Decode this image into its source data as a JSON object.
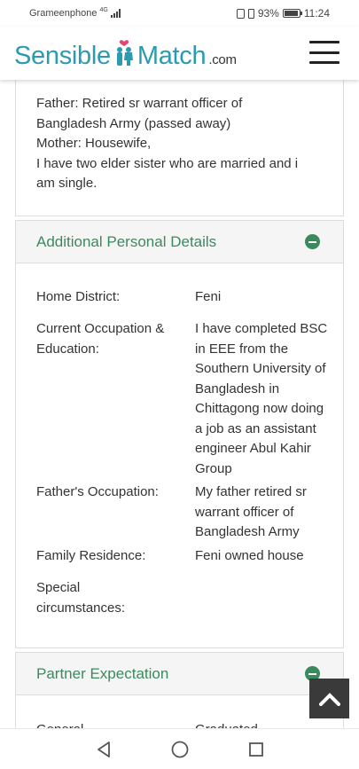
{
  "status_bar": {
    "carrier": "Grameenphone",
    "network": "4G",
    "battery_percent": "93%",
    "battery_level": 0.93,
    "time": "11:24"
  },
  "header": {
    "logo_part1": "Sensible",
    "logo_part2": "Match",
    "logo_suffix": ".com",
    "menu_icon": "hamburger-icon"
  },
  "family_info": {
    "lines": [
      "Father: Retired sr warrant officer of",
      "Bangladesh Army (passed away)",
      "Mother: Housewife,",
      "I have two elder sister who are married and i",
      "am single."
    ]
  },
  "additional_details": {
    "title": "Additional Personal Details",
    "toggle_icon": "minus-circle-icon",
    "rows": [
      {
        "label": "Home District:",
        "value": "Feni"
      },
      {
        "label": "Current Occupation & Education:",
        "value": "I have completed BSC in EEE from the Southern University of Bangladesh in Chittagong now doing a job as an assistant engineer Abul Kahir Group"
      },
      {
        "label": "Father's Occupation:",
        "value": "My father retired sr warrant officer of Bangladesh Army"
      },
      {
        "label": "Family Residence:",
        "value": "Feni owned house"
      },
      {
        "label": "Special circumstances:",
        "value": ""
      }
    ]
  },
  "partner_expectation": {
    "title": "Partner Expectation",
    "toggle_icon": "minus-circle-icon",
    "first_row": {
      "label": "General",
      "value": "Graduated"
    }
  },
  "scroll_top_icon": "chevron-up-icon",
  "nav": {
    "back_icon": "back-triangle-icon",
    "home_icon": "home-circle-icon",
    "recents_icon": "recents-square-icon"
  },
  "colors": {
    "brand_teal": "#2a9bb0",
    "section_green": "#3b8a5e",
    "header_bg": "#f5f5f5"
  }
}
